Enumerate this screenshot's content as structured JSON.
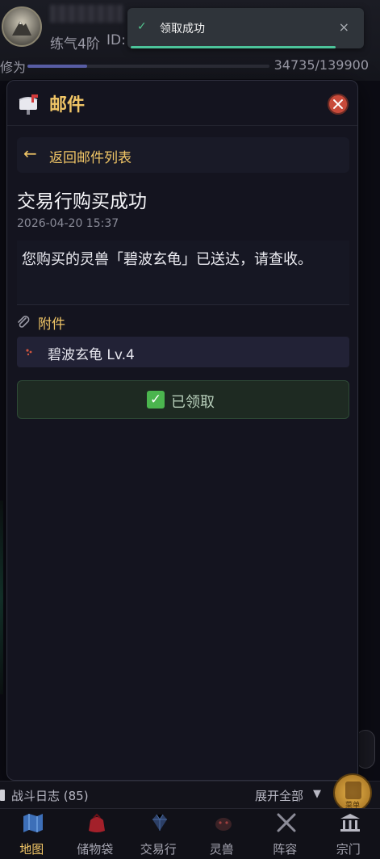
{
  "header": {
    "realm": "练气4阶",
    "id_label": "ID:",
    "exp_label": "修为",
    "exp_value": "34735/139900",
    "exp_fraction": 0.248
  },
  "toast": {
    "message": "领取成功",
    "check_icon": "check-icon",
    "close_icon": "close-icon"
  },
  "mail_modal": {
    "title": "邮件",
    "back_label": "返回邮件列表",
    "subject": "交易行购买成功",
    "date": "2026-04-20 15:37",
    "body": "您购买的灵兽「碧波玄龟」已送达，请查收。",
    "attachments_label": "附件",
    "attachment_item": "碧波玄龟 Lv.4",
    "claimed_label": "已领取",
    "accent_color": "#f0c566",
    "close_color": "#c84a3a"
  },
  "bottom": {
    "battle_log": "战斗日志 (85)",
    "expand_all": "展开全部",
    "menu_label": "菜单",
    "nav": [
      {
        "label": "地图",
        "icon": "map-icon"
      },
      {
        "label": "储物袋",
        "icon": "bag-icon"
      },
      {
        "label": "交易行",
        "icon": "gem-icon"
      },
      {
        "label": "灵兽",
        "icon": "beast-icon"
      },
      {
        "label": "阵容",
        "icon": "swords-icon"
      },
      {
        "label": "宗门",
        "icon": "temple-icon"
      }
    ]
  }
}
